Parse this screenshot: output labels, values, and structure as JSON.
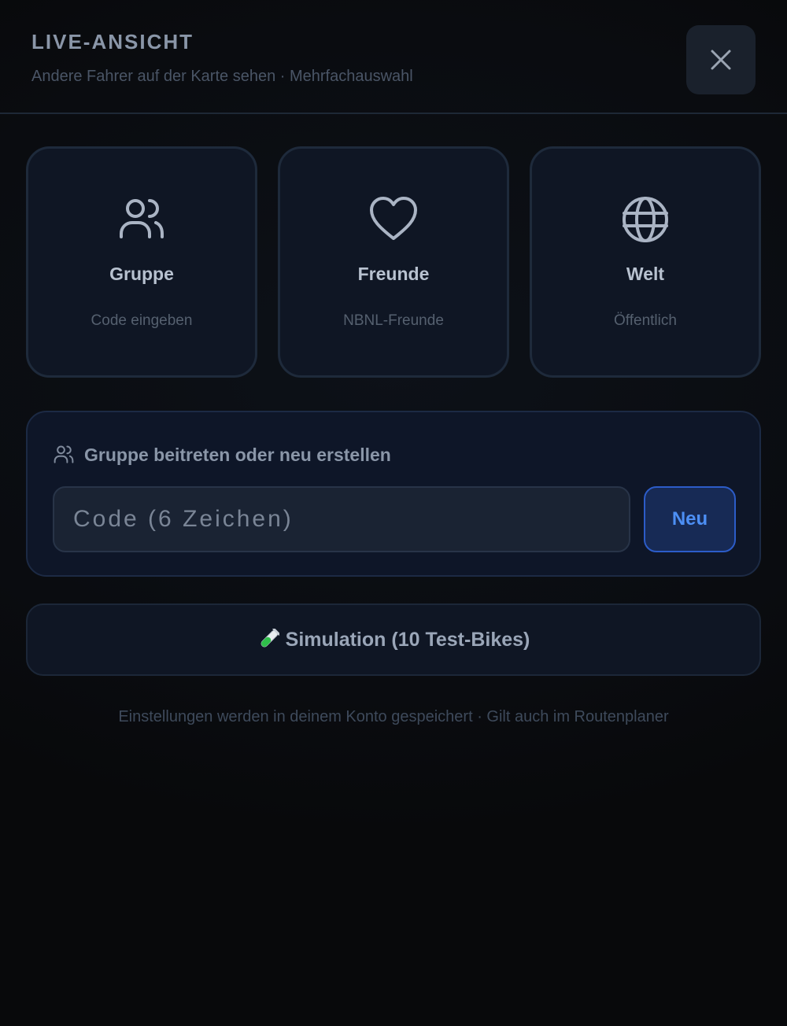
{
  "header": {
    "title": "LIVE-ANSICHT",
    "subtitle": "Andere Fahrer auf der Karte sehen · Mehrfachauswahl",
    "close_icon": "close-icon"
  },
  "cards": [
    {
      "icon": "users-icon",
      "label": "Gruppe",
      "sub": "Code eingeben"
    },
    {
      "icon": "heart-icon",
      "label": "Freunde",
      "sub": "NBNL-Freunde"
    },
    {
      "icon": "globe-icon",
      "label": "Welt",
      "sub": "Öffentlich"
    }
  ],
  "group_panel": {
    "icon": "users-icon",
    "heading": "Gruppe beitreten oder neu erstellen",
    "code_input": {
      "value": "",
      "placeholder": "Code (6 Zeichen)"
    },
    "new_button_label": "Neu"
  },
  "simulation": {
    "icon": "test-tube-icon",
    "label": "Simulation (10 Test-Bikes)"
  },
  "footer_note": "Einstellungen werden in deinem Konto gespeichert · Gilt auch im Routenplaner",
  "colors": {
    "background": "#0a0c10",
    "card_bg": "#0f1624",
    "card_border": "#1e2a3b",
    "accent_blue": "#4d8ff5",
    "text_primary": "#b8c2d0",
    "text_muted": "#55606f"
  }
}
